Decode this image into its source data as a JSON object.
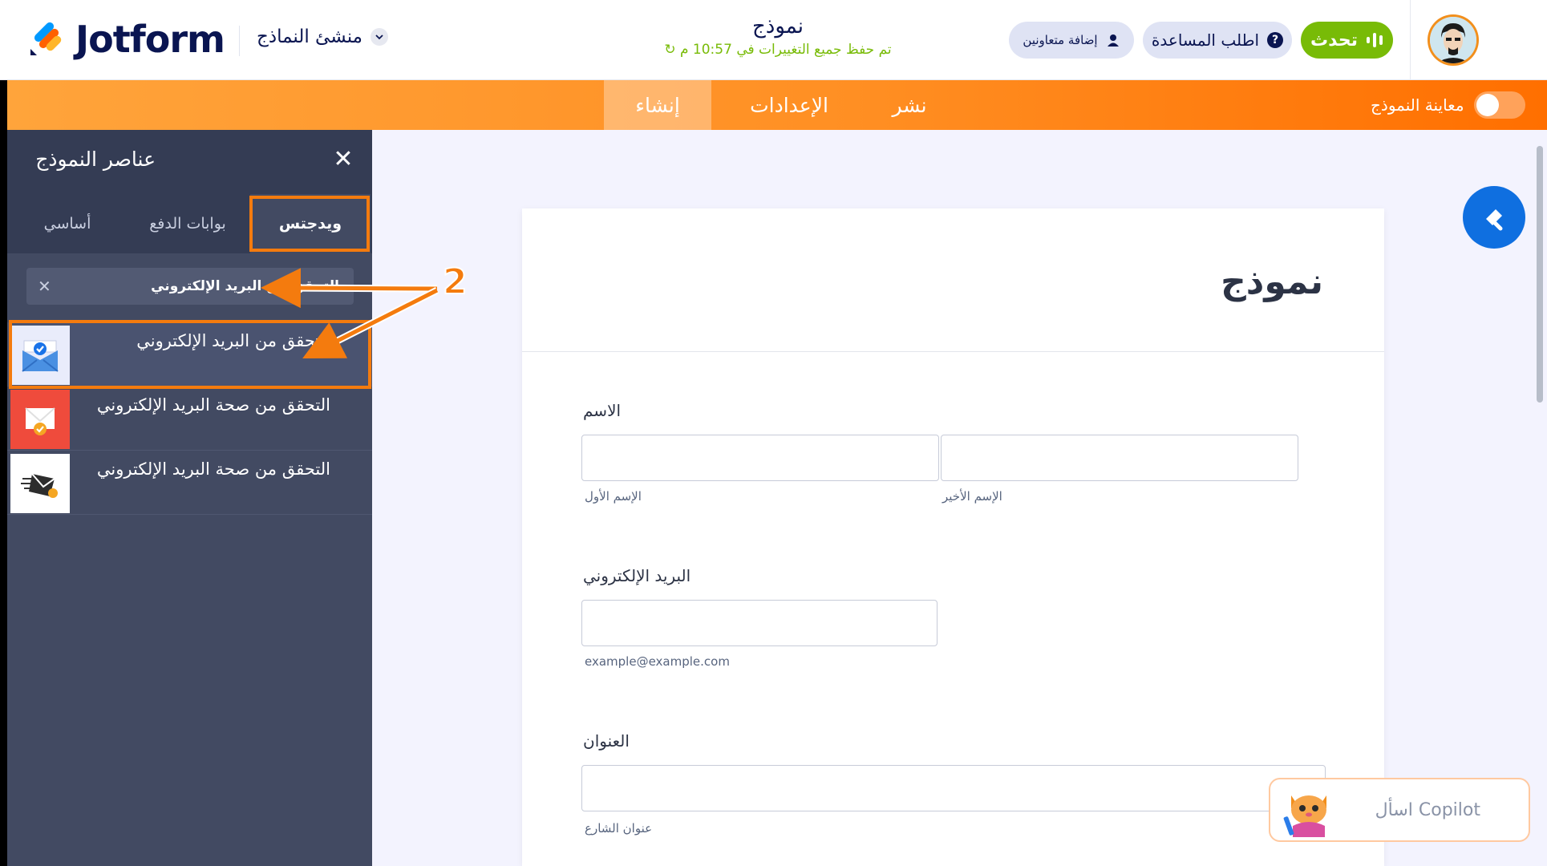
{
  "header": {
    "logo_text": "Jotform",
    "builder_label": "منشئ النماذج",
    "form_title": "نموذج",
    "saved_status": "تم حفظ جميع التغييرات في 10:57 م",
    "collab_label": "إضافة متعاونين",
    "help_label": "اطلب المساعدة",
    "talk_label": "تحدث"
  },
  "nav": {
    "create": "إنشاء",
    "settings": "الإعدادات",
    "publish": "نشر",
    "preview_label": "معاينة النموذج",
    "preview_on": false
  },
  "sidebar": {
    "title": "عناصر النموذج",
    "tabs": [
      "أساسي",
      "بوابات الدفع",
      "ويدجتس"
    ],
    "active_tab": "ويدجتس",
    "search_query": "التحقق من البريد الإلكتروني",
    "results": [
      {
        "label": "التحقق من البريد الإلكتروني",
        "icon": "email-verified-envelope-icon"
      },
      {
        "label": "التحقق من صحة البريد الإلكتروني",
        "icon": "email-validation-red-icon"
      },
      {
        "label": "التحقق من صحة البريد الإلكتروني",
        "icon": "email-send-check-icon"
      }
    ]
  },
  "form": {
    "heading": "نموذج",
    "name_label": "الاسم",
    "first_name_sub": "الإسم الأول",
    "last_name_sub": "الإسم الأخير",
    "email_label": "البريد الإلكتروني",
    "email_sub": "example@example.com",
    "address_label": "العنوان",
    "street_sub": "عنوان الشارع"
  },
  "copilot": {
    "label": "اسأل Copilot"
  },
  "annotation": {
    "step_number": "2"
  },
  "colors": {
    "brand_navy": "#0a1551",
    "orange": "#ff8f23",
    "green": "#78bb07",
    "sidebar_bg": "#424a62",
    "highlight": "#f47b0e"
  }
}
